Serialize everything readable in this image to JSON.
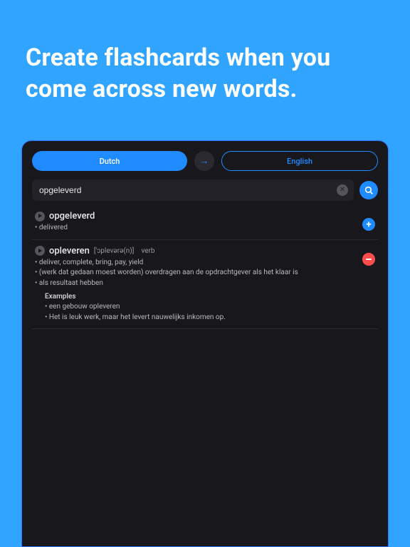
{
  "headline": "Create flashcards when you come across new words.",
  "langs": {
    "source": "Dutch",
    "target": "English"
  },
  "search": {
    "value": "opgeleverd"
  },
  "entries": [
    {
      "headword": "opgeleverd",
      "pron": "",
      "pos": "",
      "defs": [
        "delivered"
      ],
      "examples_title": "",
      "examples": [],
      "action": "add"
    },
    {
      "headword": "opleveren",
      "pron": "['ɔplevərə(n)]",
      "pos": "verb",
      "defs": [
        "deliver, complete, bring, pay, yield",
        "(werk dat gedaan moest worden) overdragen aan de opdrachtgever als het klaar is",
        "als resultaat hebben"
      ],
      "examples_title": "Examples",
      "examples": [
        "een gebouw opleveren",
        "Het is leuk werk, maar het levert nauwelijks inkomen op."
      ],
      "action": "remove"
    }
  ]
}
